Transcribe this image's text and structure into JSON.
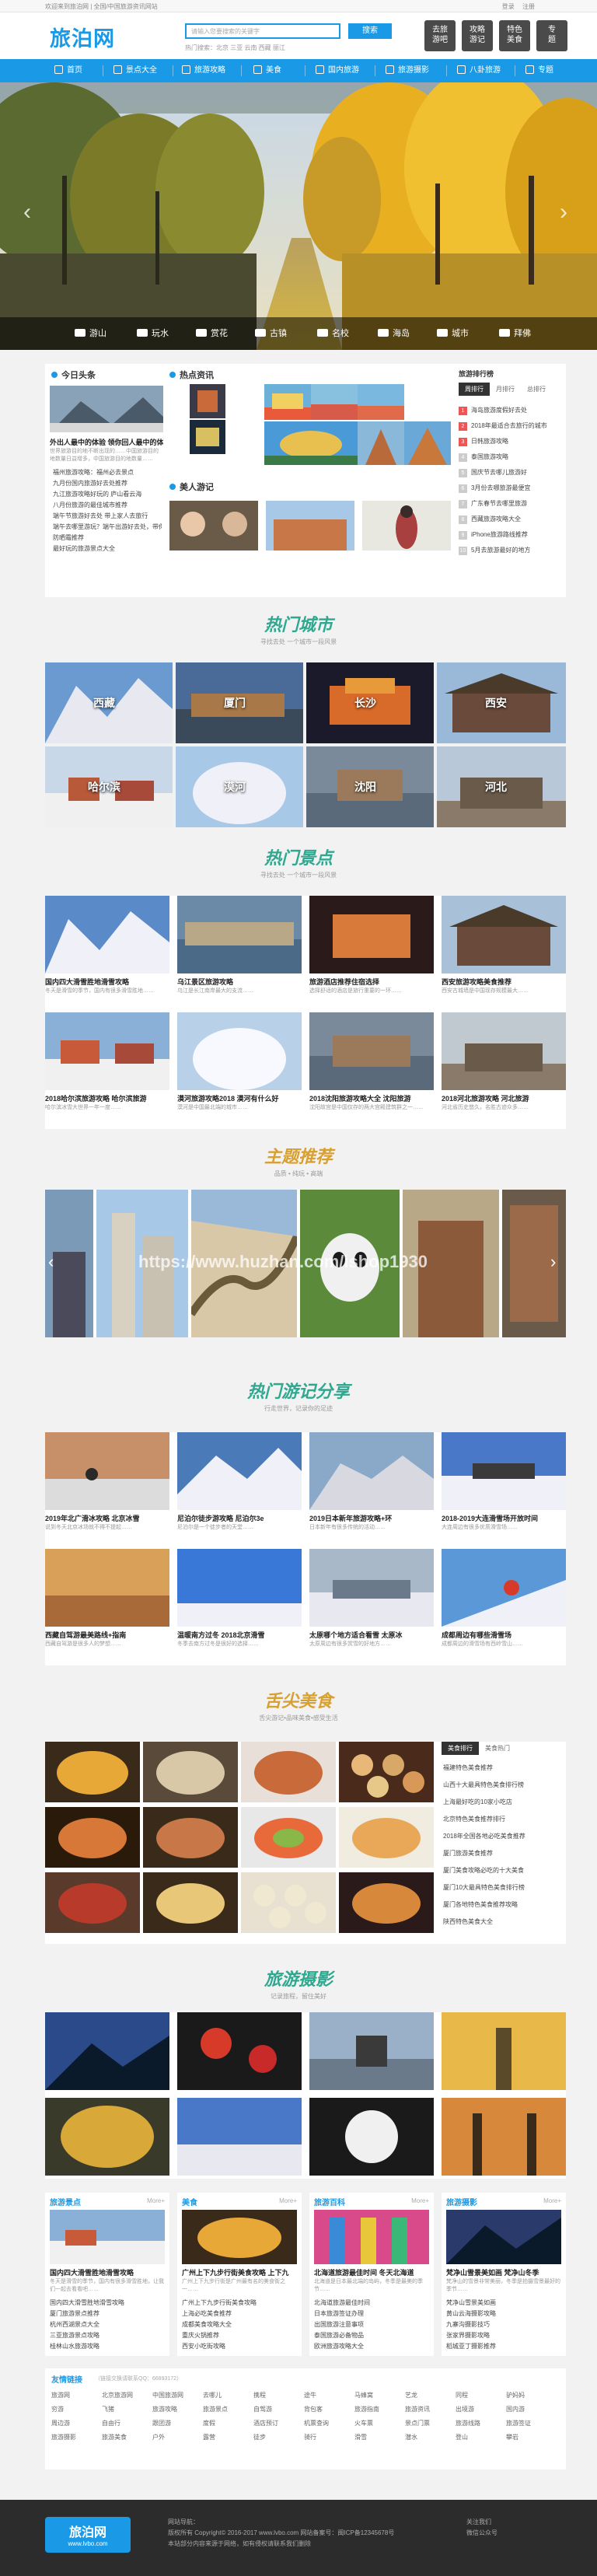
{
  "topbar": {
    "left": "欢迎来到旅泊网 | 全国/中国旅游资讯网站",
    "right": [
      "登录",
      "注册"
    ]
  },
  "header": {
    "logo": "旅泊网",
    "search_placeholder": "请输入您要搜索的关键字",
    "search_button": "搜索",
    "hotwords": "热门搜索：北京  三亚  云南  西藏  丽江",
    "buttons": [
      {
        "line1": "去旅",
        "line2": "游吧"
      },
      {
        "line1": "攻略",
        "line2": "游记"
      },
      {
        "line1": "特色",
        "line2": "美食"
      },
      {
        "line1": "专",
        "line2": "题"
      }
    ]
  },
  "nav": {
    "items": [
      "首页",
      "景点大全",
      "旅游攻略",
      "美食",
      "国内旅游",
      "旅游摄影",
      "八卦旅游",
      "专题"
    ]
  },
  "hero": {
    "categories": [
      "游山",
      "玩水",
      "赏花",
      "古镇",
      "名校",
      "海岛",
      "城市",
      "拜佛"
    ]
  },
  "headlines": {
    "title": "今日头条",
    "feature_title": "外出人最中的体验 领你回人最中的体验",
    "feature_desc": "世界旅游目的地不断出现的……中国旅游目的地数量日益增多，中国旅游目的地数量……",
    "items": [
      "福州旅游攻略：福州必去景点",
      "九月份国内旅游好去处推荐",
      "九江旅游攻略好玩的 庐山看云海",
      "八月份旅游的最佳城市推荐",
      "端午节旅游好去处 带上家人去旅行",
      "端午去哪里游玩？端午出游好去处，带你一路",
      "防晒霜推荐",
      "最好玩的旅游景点大全"
    ]
  },
  "hotinfo": {
    "title": "热点资讯"
  },
  "beauty": {
    "title": "美人游记"
  },
  "ranking": {
    "title": "旅游排行榜",
    "tabs": [
      "周排行",
      "月排行",
      "总排行"
    ],
    "items": [
      "海岛旅游度假好去处",
      "2018年最适合去旅行的城市",
      "日韩旅游攻略",
      "泰国旅游攻略",
      "国庆节去哪儿旅游好",
      "3月份去哪旅游最便宜",
      "广东春节去哪里旅游",
      "西藏旅游攻略大全",
      "iPhone旅游路线推荐",
      "5月去旅游最好的地方"
    ]
  },
  "hot_cities": {
    "title": "热门城市",
    "subtitle": "寻找去处 一个城市一段风景",
    "labels": [
      "西藏",
      "厦门",
      "长沙",
      "西安",
      "哈尔滨",
      "漠河",
      "沈阳",
      "河北"
    ]
  },
  "hot_scenic": {
    "title": "热门景点",
    "subtitle": "寻找去处 一个城市一段风景",
    "items": [
      {
        "title": "国内四大滑雪胜地滑雪攻略",
        "desc": "冬天是滑雪的季节，国内有很多滑雪胜地……"
      },
      {
        "title": "乌江景区旅游攻略",
        "desc": "乌江是长江南岸最大的支流……"
      },
      {
        "title": "旅游酒店推荐住宿选择",
        "desc": "选择舒适的酒店是旅行重要的一环……"
      },
      {
        "title": "西安旅游攻略美食推荐",
        "desc": "西安古城墙是中国现存规模最大……"
      },
      {
        "title": "2018哈尔滨旅游攻略 哈尔滨旅游",
        "desc": "哈尔滨冰雪大世界一年一度……"
      },
      {
        "title": "漠河旅游攻略2018 漠河有什么好",
        "desc": "漠河是中国最北端的城市……"
      },
      {
        "title": "2018沈阳旅游攻略大全 沈阳旅游",
        "desc": "沈阳故宫是中国仅存的两大宫殿建筑群之一……"
      },
      {
        "title": "2018河北旅游攻略 河北旅游",
        "desc": "河北省历史悠久，名胜古迹众多……"
      }
    ]
  },
  "topics": {
    "title": "主题推荐",
    "subtitle": "品质 • 纯玩 • 高端"
  },
  "watermark": "https://www.huzhan.com/ishop1930",
  "travelogues": {
    "title": "热门游记分享",
    "subtitle": "行走世界，记录你的足迹",
    "items": [
      {
        "title": "2019年北广滑冰攻略 北京冰雪",
        "desc": "说到冬天北京冰场就不得不提起……"
      },
      {
        "title": "尼泊尔徒步游攻略 尼泊尔3e",
        "desc": "尼泊尔是一个徒步者的天堂……"
      },
      {
        "title": "2019日本新年旅游攻略+环",
        "desc": "日本新年有很多传统的活动……"
      },
      {
        "title": "2018-2019大连滑雪场开放时间",
        "desc": "大连周边有很多优质滑雪场……"
      },
      {
        "title": "西藏自驾游最美路线+指南",
        "desc": "西藏自驾游是很多人的梦想……"
      },
      {
        "title": "温暖南方过冬 2018北京滑雪",
        "desc": "冬季去南方过冬是很好的选择……"
      },
      {
        "title": "太原哪个地方适合看雪 太原冰",
        "desc": "太原周边有很多赏雪的好地方……"
      },
      {
        "title": "成都周边有哪些滑雪场",
        "desc": "成都周边的滑雪场有西岭雪山……"
      }
    ]
  },
  "food": {
    "title": "舌尖美食",
    "subtitle": "舌尖游记•品味美食•感受生活",
    "tabs": [
      "美食排行",
      "美食热门"
    ],
    "items": [
      "福建特色美食推荐",
      "山西十大最具特色美食排行榜",
      "上海最好吃的10家小吃店",
      "北京特色美食推荐排行",
      "2018年全国各地必吃美食推荐",
      "厦门旅游美食推荐",
      "厦门美食攻略必吃的十大美食",
      "厦门10大最具特色美食排行榜",
      "厦门各地特色美食推荐攻略",
      "陕西特色美食大全"
    ]
  },
  "photography": {
    "title": "旅游摄影",
    "subtitle": "记录旅程，留住美好"
  },
  "columns": [
    {
      "title": "旅游景点",
      "more": "More+",
      "feature": "国内四大滑雪胜地滑雪攻略",
      "desc": "冬天是滑雪的季节，国内有很多滑雪胜地，让我们一起去看看吧……",
      "items": [
        "国内四大滑雪胜地滑雪攻略",
        "厦门旅游景点推荐",
        "杭州西湖景点大全",
        "三亚旅游景点攻略",
        "桂林山水旅游攻略"
      ]
    },
    {
      "title": "美食",
      "more": "More+",
      "feature": "广州上下九步行街美食攻略 上下九",
      "desc": "广州上下九步行街是广州最有名的美食街之一……",
      "items": [
        "广州上下九步行街美食攻略",
        "上海必吃美食推荐",
        "成都美食攻略大全",
        "重庆火锅推荐",
        "西安小吃街攻略"
      ]
    },
    {
      "title": "旅游百科",
      "more": "More+",
      "feature": "北海道旅游最佳时间 冬天北海道",
      "desc": "北海道是日本最北端的岛屿，冬季是最美的季节……",
      "items": [
        "北海道旅游最佳时间",
        "日本旅游签证办理",
        "出国旅游注意事项",
        "泰国旅游必备物品",
        "欧洲旅游攻略大全"
      ]
    },
    {
      "title": "旅游摄影",
      "more": "More+",
      "feature": "梵净山雪景美如画 梵净山冬季",
      "desc": "梵净山的雪景非常美丽，冬季是拍摄雪景最好的季节……",
      "items": [
        "梵净山雪景美如画",
        "黄山云海摄影攻略",
        "九寨沟摄影技巧",
        "张家界摄影攻略",
        "稻城亚丁摄影推荐"
      ]
    }
  ],
  "friends": {
    "title": "友情链接",
    "hint": "（链接交换请联系QQ：66893172）",
    "links": [
      "旅游网",
      "北京旅游网",
      "中国旅游网",
      "去哪儿",
      "携程",
      "途牛",
      "马蜂窝",
      "艺龙",
      "同程",
      "驴妈妈",
      "穷游",
      "飞猪",
      "旅游攻略",
      "旅游景点",
      "自驾游",
      "背包客",
      "旅游指南",
      "旅游资讯",
      "出境游",
      "国内游",
      "周边游",
      "自由行",
      "跟团游",
      "度假",
      "酒店预订",
      "机票查询",
      "火车票",
      "景点门票",
      "旅游线路",
      "旅游签证",
      "旅游摄影",
      "旅游美食",
      "户外",
      "露营",
      "徒步",
      "骑行",
      "滑雪",
      "潜水",
      "登山",
      "攀岩"
    ]
  },
  "footer": {
    "logo": "旅泊网",
    "logo_sub": "www.lvbo.com",
    "lines": [
      "网站导航：",
      "版权所有 Copyright© 2016-2017 www.lvbo.com 网站备案号：闽ICP备12345678号",
      "本站部分内容来源于网络，如有侵权请联系我们删除"
    ],
    "right": [
      "关注我们",
      "微信公众号"
    ]
  },
  "colors": {
    "accent": "#1a9ae6",
    "section_title": "#2fa890",
    "dark": "#2c2c2c"
  }
}
